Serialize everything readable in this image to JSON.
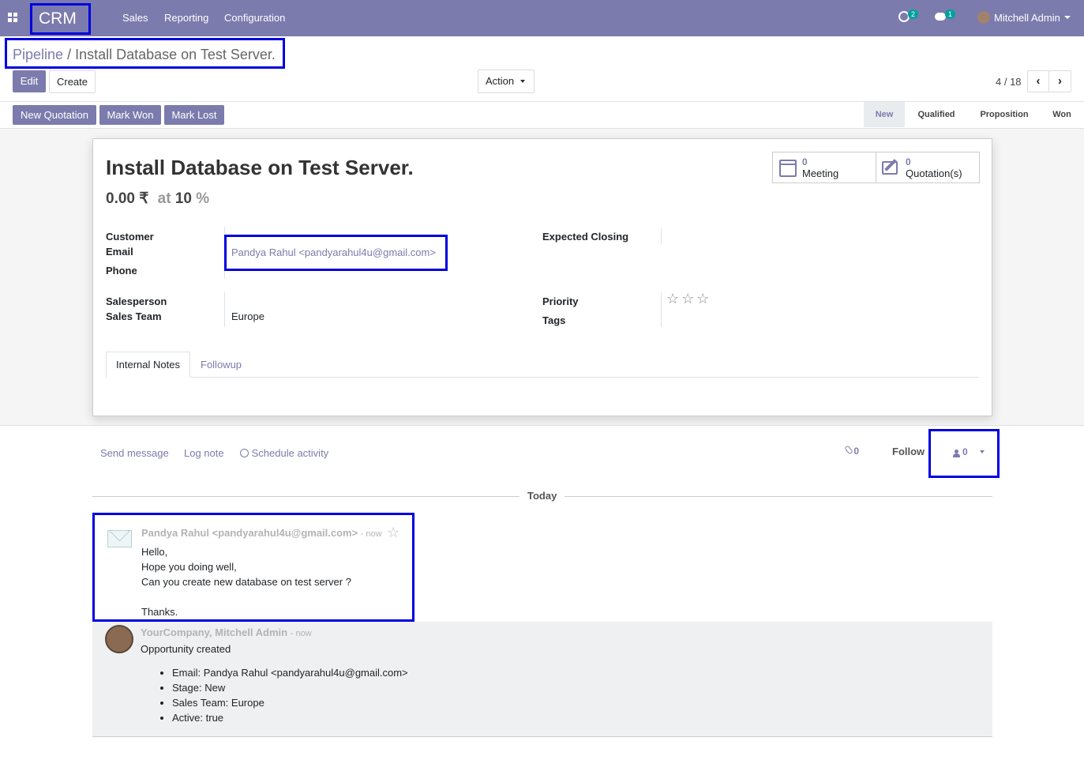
{
  "topbar": {
    "app_name": "CRM",
    "menu": [
      "Sales",
      "Reporting",
      "Configuration"
    ],
    "activity_count": "2",
    "message_count": "1",
    "user_name": "Mitchell Admin"
  },
  "breadcrumb": {
    "parent": "Pipeline",
    "separator": "/",
    "current": "Install Database on Test Server."
  },
  "controls": {
    "edit": "Edit",
    "create": "Create",
    "action": "Action",
    "pager": "4 / 18"
  },
  "statusbar": {
    "buttons": [
      "New Quotation",
      "Mark Won",
      "Mark Lost"
    ],
    "stages": [
      "New",
      "Qualified",
      "Proposition",
      "Won"
    ],
    "active_stage": "New"
  },
  "form": {
    "title": "Install Database on Test Server.",
    "revenue": "0.00",
    "currency": "₹",
    "at": "at",
    "probability": "10",
    "percent": "%",
    "smart_buttons": [
      {
        "count": "0",
        "label": "Meeting"
      },
      {
        "count": "0",
        "label": "Quotation(s)"
      }
    ],
    "labels": {
      "customer": "Customer",
      "email": "Email",
      "phone": "Phone",
      "salesperson": "Salesperson",
      "sales_team": "Sales Team",
      "expected_closing": "Expected Closing",
      "priority": "Priority",
      "tags": "Tags"
    },
    "email_value": "Pandya Rahul <pandyarahul4u@gmail.com>",
    "sales_team_value": "Europe",
    "tabs": [
      "Internal Notes",
      "Followup"
    ]
  },
  "chatter": {
    "send_message": "Send message",
    "log_note": "Log note",
    "schedule_activity": "Schedule activity",
    "attachments": "0",
    "follow": "Follow",
    "followers": "0",
    "date_separator": "Today",
    "messages": [
      {
        "author": "Pandya Rahul <pandyarahul4u@gmail.com>",
        "time": "- now",
        "lines": [
          "Hello,",
          "Hope you doing well,",
          "Can you create new database on test server ?",
          "",
          "Thanks."
        ]
      },
      {
        "author": "YourCompany, Mitchell Admin",
        "time": "- now",
        "body": "Opportunity created",
        "items": [
          "Email: Pandya Rahul <pandyarahul4u@gmail.com>",
          "Stage: New",
          "Sales Team: Europe",
          "Active: true"
        ]
      }
    ]
  },
  "colors": {
    "brand": "#7c7bad",
    "highlight": "#0000e0",
    "badge": "#00a09d"
  }
}
